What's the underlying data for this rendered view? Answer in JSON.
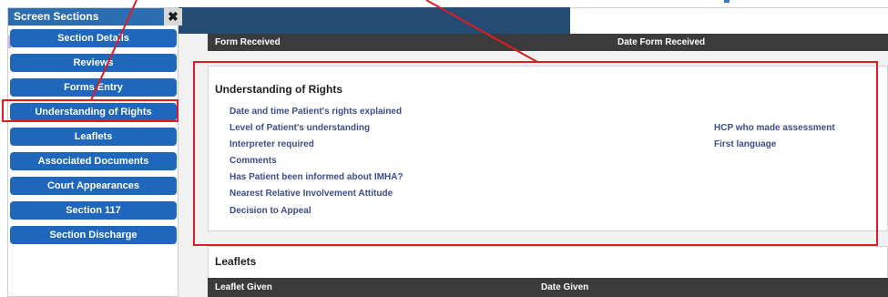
{
  "sidebar": {
    "title": "Screen Sections",
    "close_glyph": "✖",
    "items": [
      {
        "label": "Section Details"
      },
      {
        "label": "Reviews"
      },
      {
        "label": "Forms Entry"
      },
      {
        "label": "Understanding of Rights"
      },
      {
        "label": "Leaflets"
      },
      {
        "label": "Associated Documents"
      },
      {
        "label": "Court Appearances"
      },
      {
        "label": "Section 117"
      },
      {
        "label": "Section Discharge"
      }
    ],
    "active_item": "Understanding of Rights"
  },
  "forms_table": {
    "col_form_received": "Form Received",
    "col_date_form_received": "Date Form Received"
  },
  "understanding_panel": {
    "title": "Understanding of Rights",
    "fields": [
      "Date and time Patient's rights explained",
      "Level of Patient's understanding",
      "Interpreter required",
      "Comments",
      "Has Patient been informed about IMHA?",
      "Nearest Relative Involvement Attitude",
      "Decision to Appeal"
    ],
    "right_fields": [
      "HCP who made assessment",
      "First language"
    ]
  },
  "leaflets_panel": {
    "title": "Leaflets",
    "col_leaflet_given": "Leaflet Given",
    "col_date_given": "Date Given"
  },
  "colors": {
    "nav_button": "#1f67bd",
    "header_dark": "#3b3b3b",
    "topbar": "#244b72",
    "annotation_red": "#e01b24",
    "field_label": "#3c4d8a"
  }
}
